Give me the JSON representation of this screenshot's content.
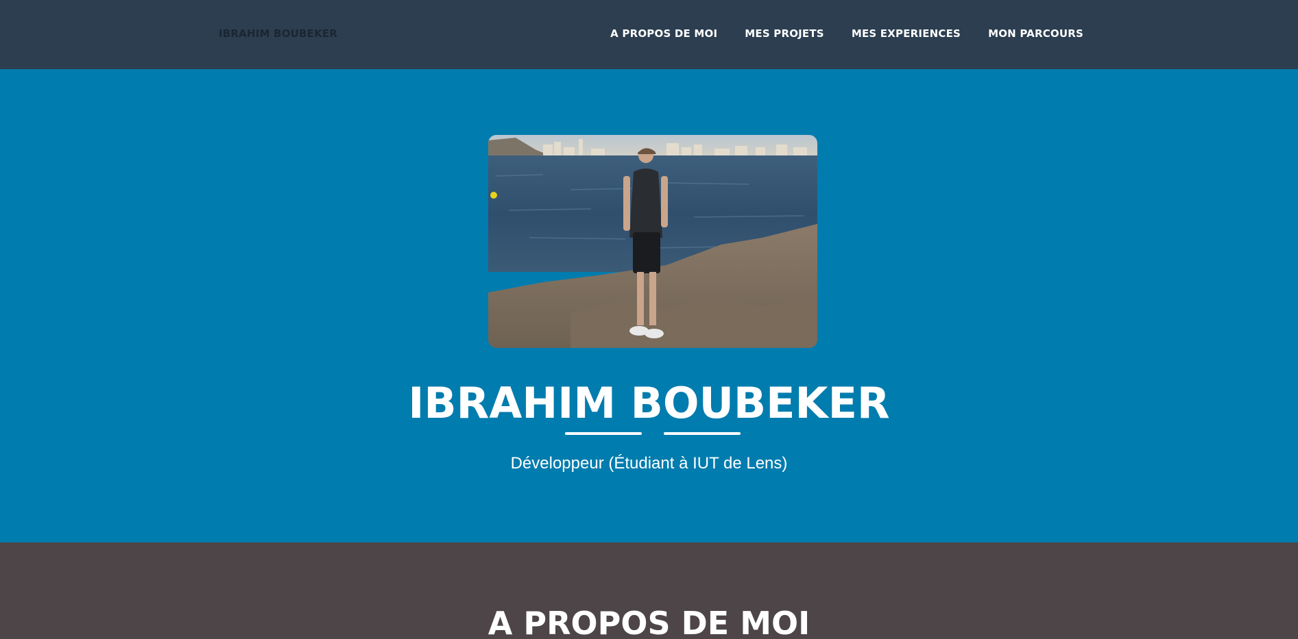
{
  "navbar": {
    "brand": "IBRAHIM BOUBEKER",
    "links": [
      {
        "label": "A PROPOS DE MOI"
      },
      {
        "label": "MES PROJETS"
      },
      {
        "label": "MES EXPERIENCES"
      },
      {
        "label": "MON PARCOURS"
      }
    ]
  },
  "masthead": {
    "name": "IBRAHIM BOUBEKER",
    "subtitle": "Développeur (Étudiant à IUT de Lens)"
  },
  "about": {
    "title": "A PROPOS DE MOI"
  },
  "colors": {
    "navbar_bg": "#2c3e50",
    "masthead_bg": "#017cae",
    "about_bg": "#4d4548",
    "text": "#ffffff"
  }
}
